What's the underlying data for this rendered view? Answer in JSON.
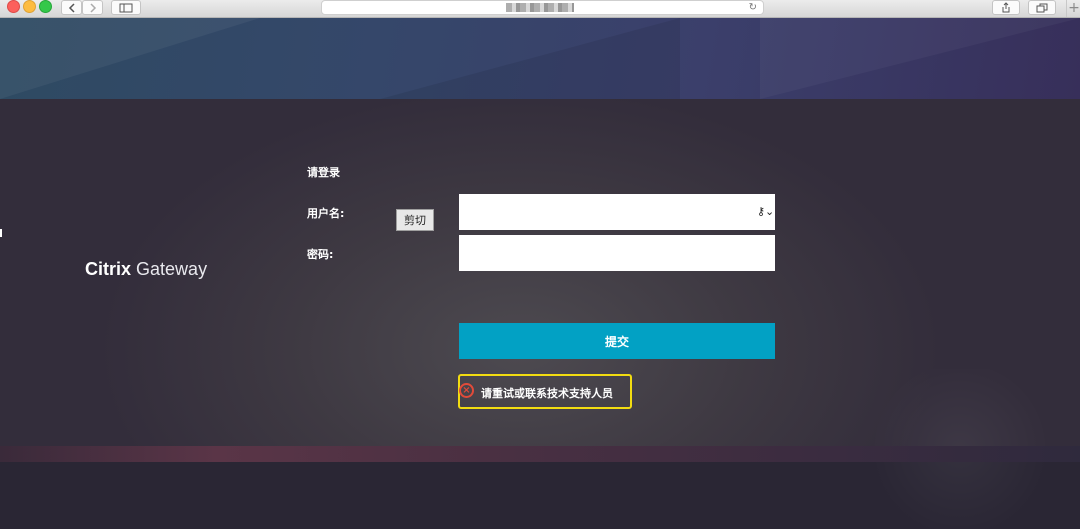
{
  "browser": {
    "reload_glyph": "↻",
    "new_tab_glyph": "+",
    "icons": [
      "back-icon",
      "forward-icon",
      "sidebar-icon",
      "share-icon",
      "tabs-icon"
    ]
  },
  "brand": {
    "name_bold": "Citrix",
    "name_light": "Gateway"
  },
  "login": {
    "heading": "请登录",
    "username_label": "用户名:",
    "username_value": "",
    "password_label": "密码:",
    "password_value": "",
    "autofill_glyph": "⚷⌄",
    "submit_label": "提交"
  },
  "context_menu": {
    "cut_label": "剪切"
  },
  "error": {
    "icon": "close-circle-icon",
    "message": "请重试或联系技术支持人员",
    "highlight_color": "#f2dc11",
    "icon_color": "#e24b3a"
  },
  "colors": {
    "accent": "#02a1c4",
    "panel": "#3e3942"
  }
}
